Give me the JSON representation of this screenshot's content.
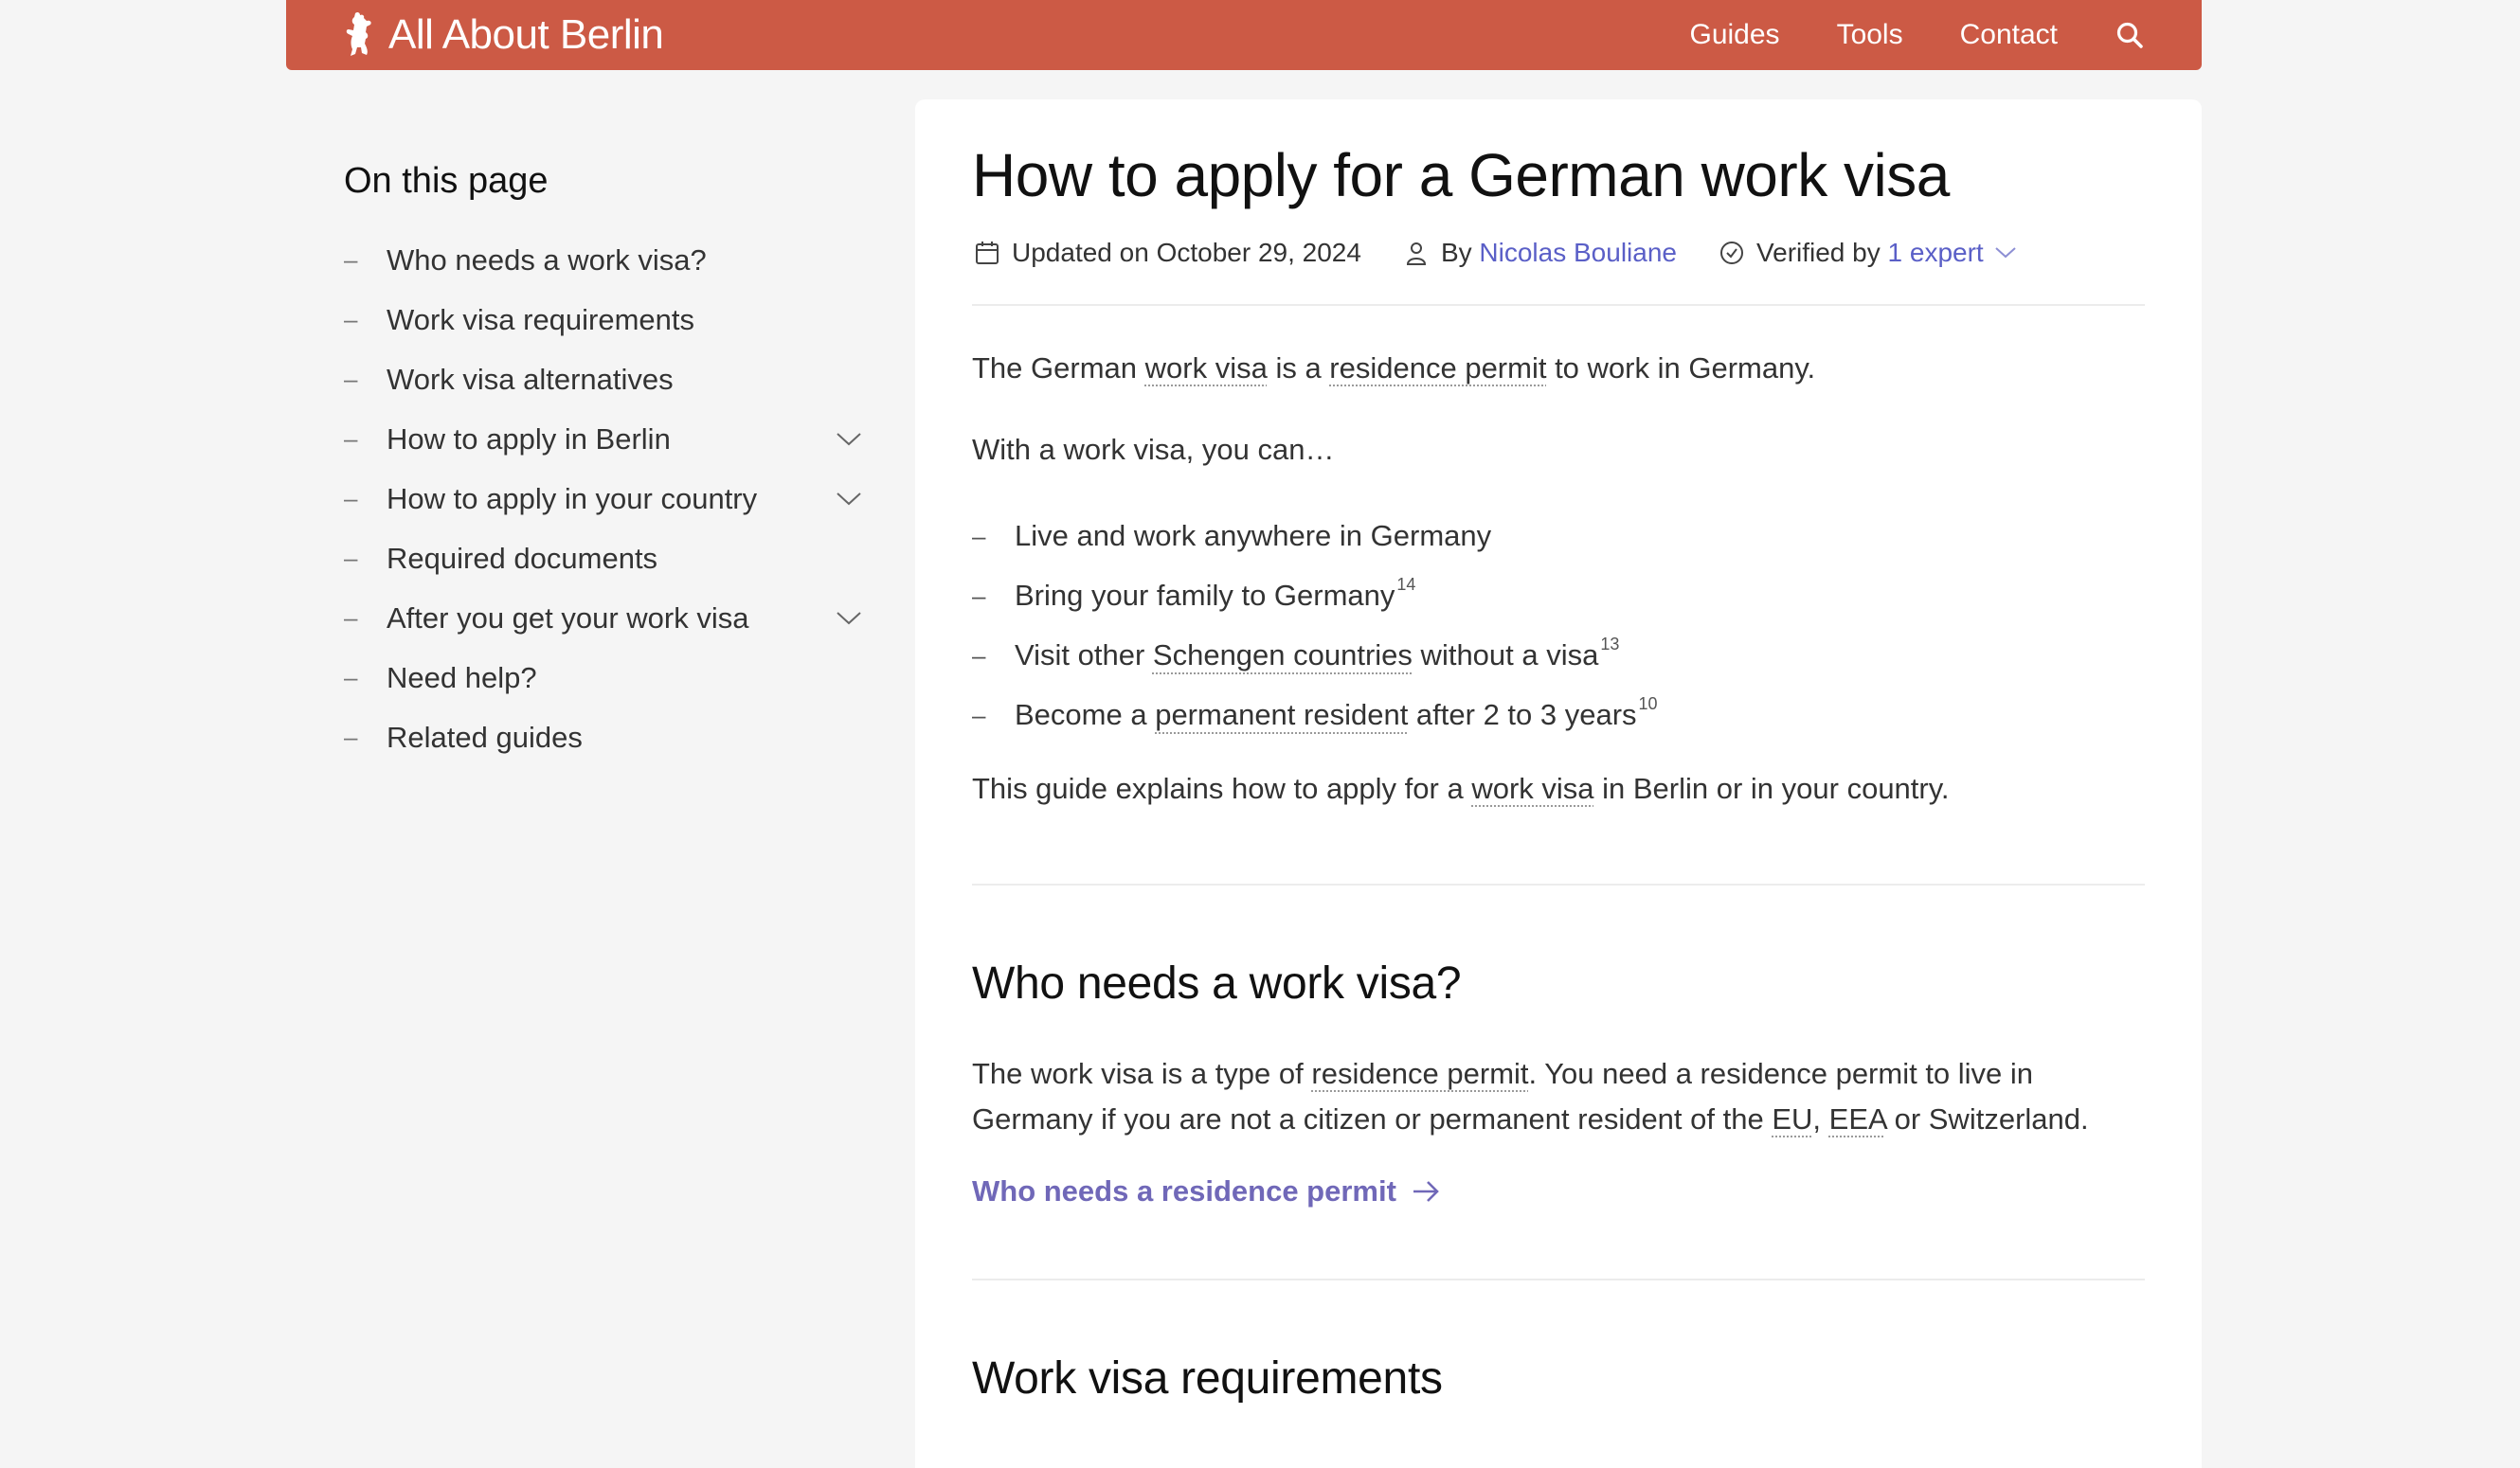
{
  "header": {
    "brand": "All About Berlin",
    "logo_icon": "berlin-bear-icon",
    "nav": [
      "Guides",
      "Tools",
      "Contact"
    ],
    "search_icon": "search-icon",
    "bg_color": "#cc5a45"
  },
  "sidebar": {
    "title": "On this page",
    "items": [
      {
        "label": "Who needs a work visa?",
        "expandable": false
      },
      {
        "label": "Work visa requirements",
        "expandable": false
      },
      {
        "label": "Work visa alternatives",
        "expandable": false
      },
      {
        "label": "How to apply in Berlin",
        "expandable": true
      },
      {
        "label": "How to apply in your country",
        "expandable": true
      },
      {
        "label": "Required documents",
        "expandable": false
      },
      {
        "label": "After you get your work visa",
        "expandable": true
      },
      {
        "label": "Need help?",
        "expandable": false
      },
      {
        "label": "Related guides",
        "expandable": false
      }
    ]
  },
  "article": {
    "title": "How to apply for a German work visa",
    "meta": {
      "updated": "Updated on October 29, 2024",
      "by_prefix": "By",
      "author": "Nicolas Bouliane",
      "verified_prefix": "Verified by",
      "verified_link": "1 expert"
    },
    "intro": {
      "t1": "The German ",
      "l1": "work visa",
      "t2": " is a ",
      "l2": "residence permit",
      "t3": " to work in Germany."
    },
    "with_visa": "With a work visa, you can…",
    "bullets": {
      "b1": "Live and work anywhere in Germany",
      "b2_text": "Bring your family to Germany",
      "b2_sup": "14",
      "b3_t1": "Visit other ",
      "b3_link": "Schengen countries",
      "b3_t2": " without a visa",
      "b3_sup": "13",
      "b4_t1": "Become a ",
      "b4_link": "permanent resident",
      "b4_t2": " after 2 to 3 years",
      "b4_sup": "10"
    },
    "guide": {
      "t1": "This guide explains how to apply for a ",
      "l1": "work visa",
      "t2": " in Berlin or in your country."
    },
    "section_who": {
      "heading": "Who needs a work visa?",
      "t1": "The work visa is a type of ",
      "l1": "residence permit",
      "t2": ". You need a residence permit to live in Germany if you are not a citizen or permanent resident of the ",
      "l2": "EU",
      "t3": ", ",
      "l3": "EEA",
      "t4": " or Switzerland.",
      "link": "Who needs a residence permit"
    },
    "section_req": {
      "heading": "Work visa requirements"
    }
  }
}
